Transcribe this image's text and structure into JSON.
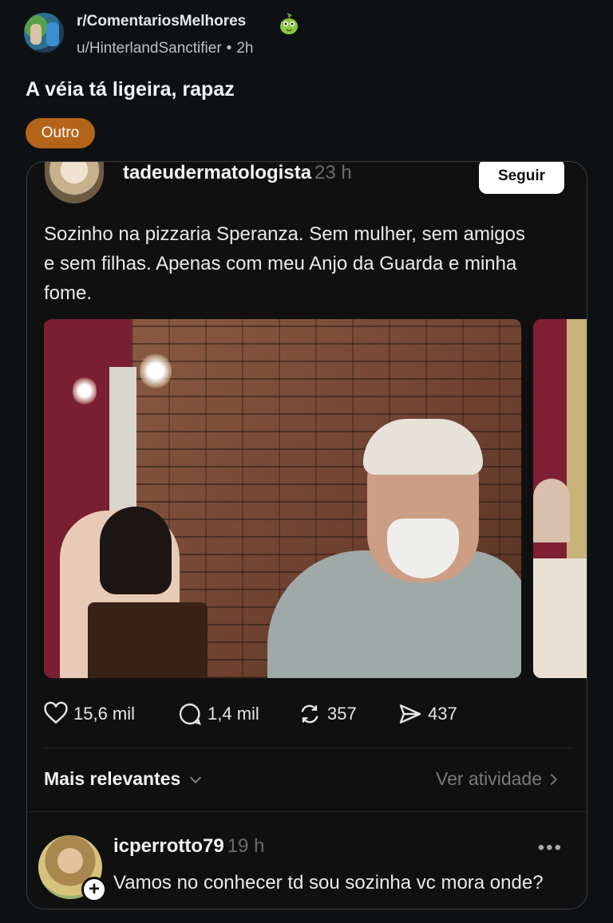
{
  "post": {
    "subreddit": "r/ComentariosMelhores",
    "author": "u/HinterlandSanctifier",
    "separator": "•",
    "age": "2h",
    "title": "A véia tá ligeira, rapaz",
    "flair": "Outro"
  },
  "embed": {
    "username": "tadeudermatologista",
    "time": "23 h",
    "follow_label": "Seguir",
    "text": "Sozinho na pizzaria Speranza. Sem mulher, sem amigos e sem filhas. Apenas com meu Anjo da Guarda e minha fome.",
    "stats": {
      "likes": "15,6 mil",
      "comments": "1,4 mil",
      "reposts": "357",
      "shares": "437"
    },
    "sort_label": "Mais relevantes",
    "activity_label": "Ver atividade",
    "comment": {
      "username": "icperrotto79",
      "time": "19 h",
      "more": "•••",
      "text": "Vamos no conhecer td sou sozinha vc mora onde?"
    }
  },
  "colors": {
    "background": "#0e1113",
    "flair": "#b4641a",
    "embed_bg": "#101010"
  }
}
